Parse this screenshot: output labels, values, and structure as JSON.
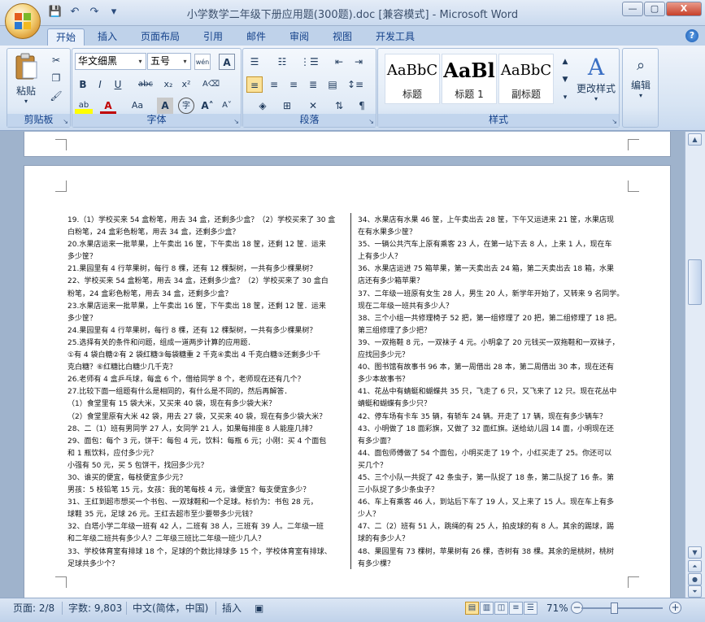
{
  "window": {
    "title": "小学数学二年级下册应用题(300题).doc [兼容模式] - Microsoft Word",
    "controls": {
      "minimize": "—",
      "maximize": "▢",
      "close": "X"
    }
  },
  "quick_access": {
    "save": "💾",
    "undo": "↶",
    "redo": "↷",
    "customize": "▾"
  },
  "tabs": [
    "开始",
    "插入",
    "页面布局",
    "引用",
    "邮件",
    "审阅",
    "视图",
    "开发工具"
  ],
  "active_tab": "开始",
  "ribbon": {
    "clipboard": {
      "label": "剪贴板",
      "paste": "粘贴"
    },
    "font": {
      "label": "字体",
      "font_name": "华文细黑",
      "font_size": "五号"
    },
    "paragraph": {
      "label": "段落"
    },
    "styles": {
      "label": "样式",
      "items": [
        {
          "sample": "AaBbC",
          "name": "标题"
        },
        {
          "sample": "AaBl",
          "name": "标题 1"
        },
        {
          "sample": "AaBbC",
          "name": "副标题"
        }
      ],
      "change_styles": "更改样式"
    },
    "editing": {
      "label": "编辑"
    }
  },
  "document": {
    "left_column": [
      "19.（1）学校买来 54 盒粉笔，用去 34 盒，还剩多少盒？（2）学校买来了 30 盒",
      "白粉笔，24 盒彩色粉笔，用去 34 盒，还剩多少盒？",
      "20.水果店运来一批苹果，上午卖出 16 筐，下午卖出 18 筐，还剩 12 筐．运来",
      "多少筐？",
      "21.果园里有 4 行苹果树，每行 8 棵，还有 12 棵梨树，一共有多少棵果树？",
      "22、学校买来 54 盒粉笔，用去 34 盒，还剩多少盒？（2）学校买来了 30 盒白",
      "粉笔，24 盒彩色粉笔，用去 34 盒，还剩多少盒？",
      "23.水果店运来一批苹果，上午卖出 16 筐，下午卖出 18 筐，还剩 12 筐．运来",
      "多少筐？",
      "24.果园里有 4 行苹果树，每行 8 棵，还有 12 棵梨树，一共有多少棵果树？",
      "25.选择有关的条件和问题，组成一道两步计算的应用题．",
      "①有 4 袋白糖②有 2 袋红糖③每袋糖重 2 千克④卖出 4 千克白糖⑤还剩多少千",
      "克白糖？⑥红糖比白糖少几千克？",
      "26.老师有 4 盒乒乓球，每盒 6 个，借给同学 8 个，老师现在还有几个？",
      "27.比较下面一组题有什么是相同的，有什么是不同的，然后再解答．",
      "（1）食堂里有 15 袋大米，又买来 40 袋，现在有多少袋大米？",
      "（2）食堂里原有大米 42 袋，用去 27 袋，又买来 40 袋，现在有多少袋大米？",
      "28、二（1）班有男同学 27 人，女同学 21 人，如果每排座 8 人能座几排？",
      "29、面包：每个 3 元，饼干：每包 4 元，饮料：每瓶 6 元；小刚：买 4 个面包",
      "和 1 瓶饮料，应付多少元？",
      "小强有 50 元，买 5 包饼干，找回多少元？",
      "30、谁买的便宜，每枝便宜多少元？",
      "男孩：5 枝铅笔 15 元，女孩：我的笔每枝 4 元，谁便宜？每支便宜多少？",
      "31、王红到超市想买一个书包、一双球鞋和一个足球。标价为：书包 28 元，",
      "球鞋 35 元，足球 26 元。王红去超市至少要带多少元钱？",
      "32、白塔小学二年级一班有 42 人，二班有 38 人，三班有 39 人。二年级一班",
      "和二年级二班共有多少人？二年级三班比二年级一班少几人？",
      "33、学校体育室有排球 18 个，足球的个数比排球多 15 个，学校体育室有排球、",
      "足球共多少个？"
    ],
    "right_column": [
      "34、水果店有水果 46 筐，上午卖出去 28 筐，下午又运进来 21 筐，水果店现",
      "在有水果多少筐？",
      "35、一辆公共汽车上原有乘客 23 人，在第一站下去 8 人，上来 1 人，现在车",
      "上有多少人？",
      "36、水果店运进 75 箱苹果，第一天卖出去 24 箱，第二天卖出去 18 箱，水果",
      "店还有多少箱苹果？",
      "37、二年级一班原有女生 28 人，男生 20 人，新学年开始了，又转来 9 名同学。",
      "现在二年级一班共有多少人？",
      "38、三个小组一共修理椅子 52 把，第一组修理了 20 把，第二组修理了 18 把。",
      "第三组修理了多少把？",
      "39、一双拖鞋 8 元，一双袜子 4 元。小明拿了 20 元钱买一双拖鞋和一双袜子，",
      "应找回多少元？",
      "40、图书馆有故事书 96 本，第一周借出 28 本，第二周借出 30 本，现在还有",
      "多少本故事书？",
      "41、花丛中有蜻蜓和蝴蝶共 35 只，飞走了 6 只，又飞来了 12 只。现在花丛中",
      "蜻蜓和蝴蝶有多少只？",
      "42、停车场有卡车 35 辆，有轿车 24 辆。开走了 17 辆，现在有多少辆车？",
      "43、小明做了 18 面彩旗，又做了 32 面红旗。送给幼儿园 14 面，小明现在还",
      "有多少面？",
      "44、面包师傅做了 54 个面包，小明买走了 19 个，小红买走了 25。你还可以",
      "买几个？",
      "45、三个小队一共捉了 42 条虫子，第一队捉了 18 条，第二队捉了 16 条。第",
      "三小队捉了多少条虫子？",
      "46、车上有乘客 46 人，到站后下车了 19 人，又上来了 15 人。现在车上有多",
      "少人？",
      "47、二（2）班有 51 人，跳绳的有 25 人，拍皮球的有 8 人。其余的踢球，踢",
      "球的有多少人？",
      "48、果园里有 73 棵树，苹果树有 26 棵，杏树有 38 棵。其余的是桃树，桃树",
      "有多少棵？"
    ]
  },
  "status": {
    "page": "页面: 2/8",
    "words": "字数: 9,803",
    "language": "中文(简体，中国)",
    "mode": "插入",
    "zoom": "71%"
  }
}
